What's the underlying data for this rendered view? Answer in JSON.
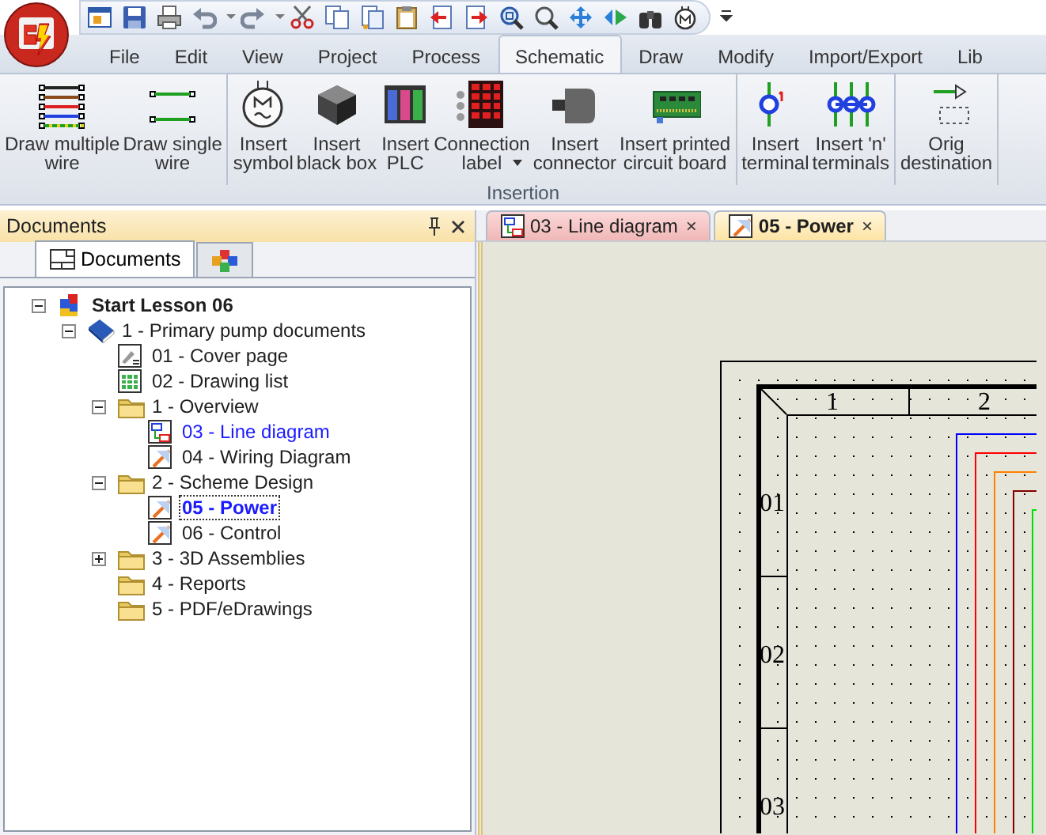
{
  "menu_tabs": [
    {
      "label": "File",
      "selected": false
    },
    {
      "label": "Edit",
      "selected": false
    },
    {
      "label": "View",
      "selected": false
    },
    {
      "label": "Project",
      "selected": false
    },
    {
      "label": "Process",
      "selected": false
    },
    {
      "label": "Schematic",
      "selected": true
    },
    {
      "label": "Draw",
      "selected": false
    },
    {
      "label": "Modify",
      "selected": false
    },
    {
      "label": "Import/Export",
      "selected": false
    },
    {
      "label": "Lib",
      "selected": false
    }
  ],
  "ribbon": {
    "sections": [
      {
        "buttons": [
          {
            "label": "Draw multiple\nwire",
            "dropdown": false
          },
          {
            "label": "Draw single\nwire",
            "dropdown": false
          }
        ]
      },
      {
        "buttons": [
          {
            "label": "Insert\nsymbol",
            "dropdown": false
          },
          {
            "label": "Insert\nblack box",
            "dropdown": false
          },
          {
            "label": "Insert\nPLC",
            "dropdown": false
          },
          {
            "label": "Connection\nlabel",
            "dropdown": true
          },
          {
            "label": "Insert\nconnector",
            "dropdown": false
          },
          {
            "label": "Insert printed\ncircuit board",
            "dropdown": false
          }
        ]
      },
      {
        "buttons": [
          {
            "label": "Insert\nterminal",
            "dropdown": false
          },
          {
            "label": "Insert 'n'\nterminals",
            "dropdown": false
          }
        ]
      },
      {
        "buttons": [
          {
            "label": "Orig\ndestination",
            "dropdown": false
          }
        ]
      }
    ],
    "group_label": "Insertion"
  },
  "documents_panel": {
    "title": "Documents",
    "tabs": [
      {
        "kind": "text",
        "label": "Documents",
        "selected": true
      },
      {
        "kind": "icon",
        "selected": false
      }
    ],
    "tree": [
      {
        "label": "Start Lesson 06",
        "kind": "project",
        "expanded": true,
        "selected": false,
        "opened": false,
        "children": [
          {
            "label": "1 - Primary pump documents",
            "kind": "book",
            "expanded": true,
            "selected": false,
            "opened": false,
            "children": [
              {
                "label": "01 - Cover page",
                "kind": "cover",
                "selected": false,
                "opened": false
              },
              {
                "label": "02 - Drawing list",
                "kind": "list",
                "selected": false,
                "opened": false
              },
              {
                "label": "1 - Overview",
                "kind": "folder",
                "expanded": true,
                "selected": false,
                "opened": false,
                "children": [
                  {
                    "label": "03 - Line diagram",
                    "kind": "diagram",
                    "selected": false,
                    "opened": true
                  },
                  {
                    "label": "04 - Wiring Diagram",
                    "kind": "scheme",
                    "selected": false,
                    "opened": false
                  }
                ]
              },
              {
                "label": "2 - Scheme Design",
                "kind": "folder",
                "expanded": true,
                "selected": false,
                "opened": false,
                "children": [
                  {
                    "label": "05 - Power",
                    "kind": "scheme",
                    "selected": true,
                    "opened": true
                  },
                  {
                    "label": "06 - Control",
                    "kind": "scheme",
                    "selected": false,
                    "opened": false
                  }
                ]
              },
              {
                "label": "3 - 3D Assemblies",
                "kind": "folder",
                "expanded": false,
                "selected": false,
                "opened": false
              },
              {
                "label": "4 - Reports",
                "kind": "folder",
                "selected": false,
                "opened": false
              },
              {
                "label": "5 - PDF/eDrawings",
                "kind": "folder",
                "selected": false,
                "opened": false
              }
            ]
          }
        ]
      }
    ]
  },
  "doc_tabs": [
    {
      "label": "03 - Line diagram",
      "kind": "diagram",
      "selected": false,
      "close": "×"
    },
    {
      "label": "05 - Power",
      "kind": "scheme",
      "selected": true,
      "close": "×"
    }
  ],
  "drawing": {
    "column_labels": [
      "1",
      "2"
    ],
    "row_labels": [
      "01",
      "02",
      "03"
    ]
  }
}
